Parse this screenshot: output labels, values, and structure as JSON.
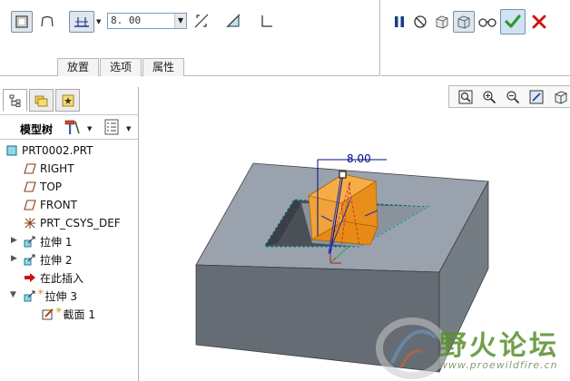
{
  "dashboard": {
    "depth_value": "8. 00",
    "tabs": [
      {
        "label": "放置"
      },
      {
        "label": "选项"
      },
      {
        "label": "属性"
      }
    ],
    "controls": {
      "pause": "pause-icon",
      "no_preview": "no-preview-icon",
      "verify": "verify-check-icon",
      "cancel": "cancel-x-icon"
    }
  },
  "model_tree": {
    "title": "模型树",
    "items": [
      {
        "label": "PRT0002.PRT",
        "icon": "part-icon"
      },
      {
        "label": "RIGHT",
        "icon": "datum-plane-icon"
      },
      {
        "label": "TOP",
        "icon": "datum-plane-icon"
      },
      {
        "label": "FRONT",
        "icon": "datum-plane-icon"
      },
      {
        "label": "PRT_CSYS_DEF",
        "icon": "csys-icon"
      },
      {
        "label": "拉伸 1",
        "icon": "extrude-icon"
      },
      {
        "label": "拉伸 2",
        "icon": "extrude-icon"
      },
      {
        "label": "在此插入",
        "icon": "insert-here-arrow-icon"
      },
      {
        "label": "拉伸 3",
        "icon": "extrude-icon"
      },
      {
        "label": "截面 1",
        "icon": "sketch-section-icon"
      }
    ]
  },
  "graphics": {
    "dimension_label": "8.00",
    "watermark_title": "野火论坛",
    "watermark_url": "www.proewildfire.cn"
  },
  "colors": {
    "block_gray": "#9aa3ad",
    "feature_orange": "#f29a1a",
    "accent_green": "#2e9a2e",
    "cancel_red": "#d01010"
  }
}
